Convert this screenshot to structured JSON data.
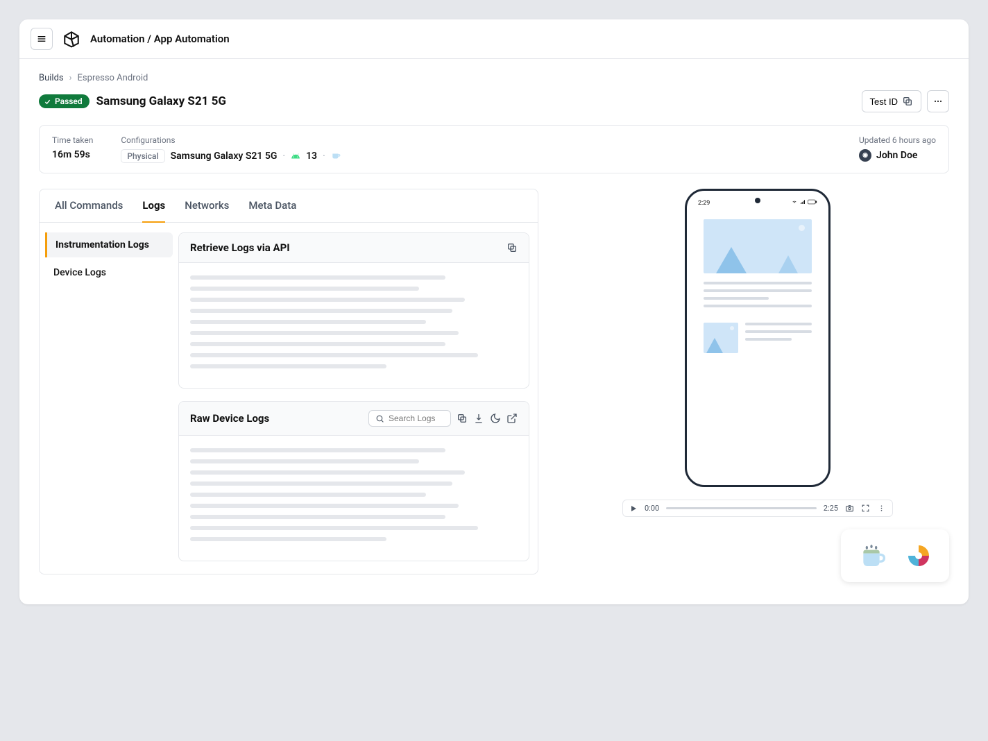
{
  "header": {
    "breadcrumb": "Automation / App Automation"
  },
  "crumbs": {
    "root": "Builds",
    "current": "Espresso Android"
  },
  "status": {
    "label": "Passed"
  },
  "title": "Samsung Galaxy S21 5G",
  "actions": {
    "test_id": "Test ID"
  },
  "meta": {
    "time_label": "Time taken",
    "time_value": "16m 59s",
    "config_label": "Configurations",
    "chip": "Physical",
    "device": "Samsung Galaxy S21 5G",
    "os_version": "13",
    "updated_label": "Updated 6 hours ago",
    "user": "John Doe"
  },
  "tabs": [
    "All Commands",
    "Logs",
    "Networks",
    "Meta Data"
  ],
  "active_tab": "Logs",
  "sidebar": {
    "items": [
      "Instrumentation Logs",
      "Device Logs"
    ],
    "active": "Instrumentation Logs"
  },
  "cards": {
    "retrieve": "Retrieve Logs via API",
    "raw": "Raw Device Logs",
    "search_placeholder": "Search Logs"
  },
  "phone": {
    "time": "2:29"
  },
  "player": {
    "current": "0:00",
    "total": "2:25"
  }
}
